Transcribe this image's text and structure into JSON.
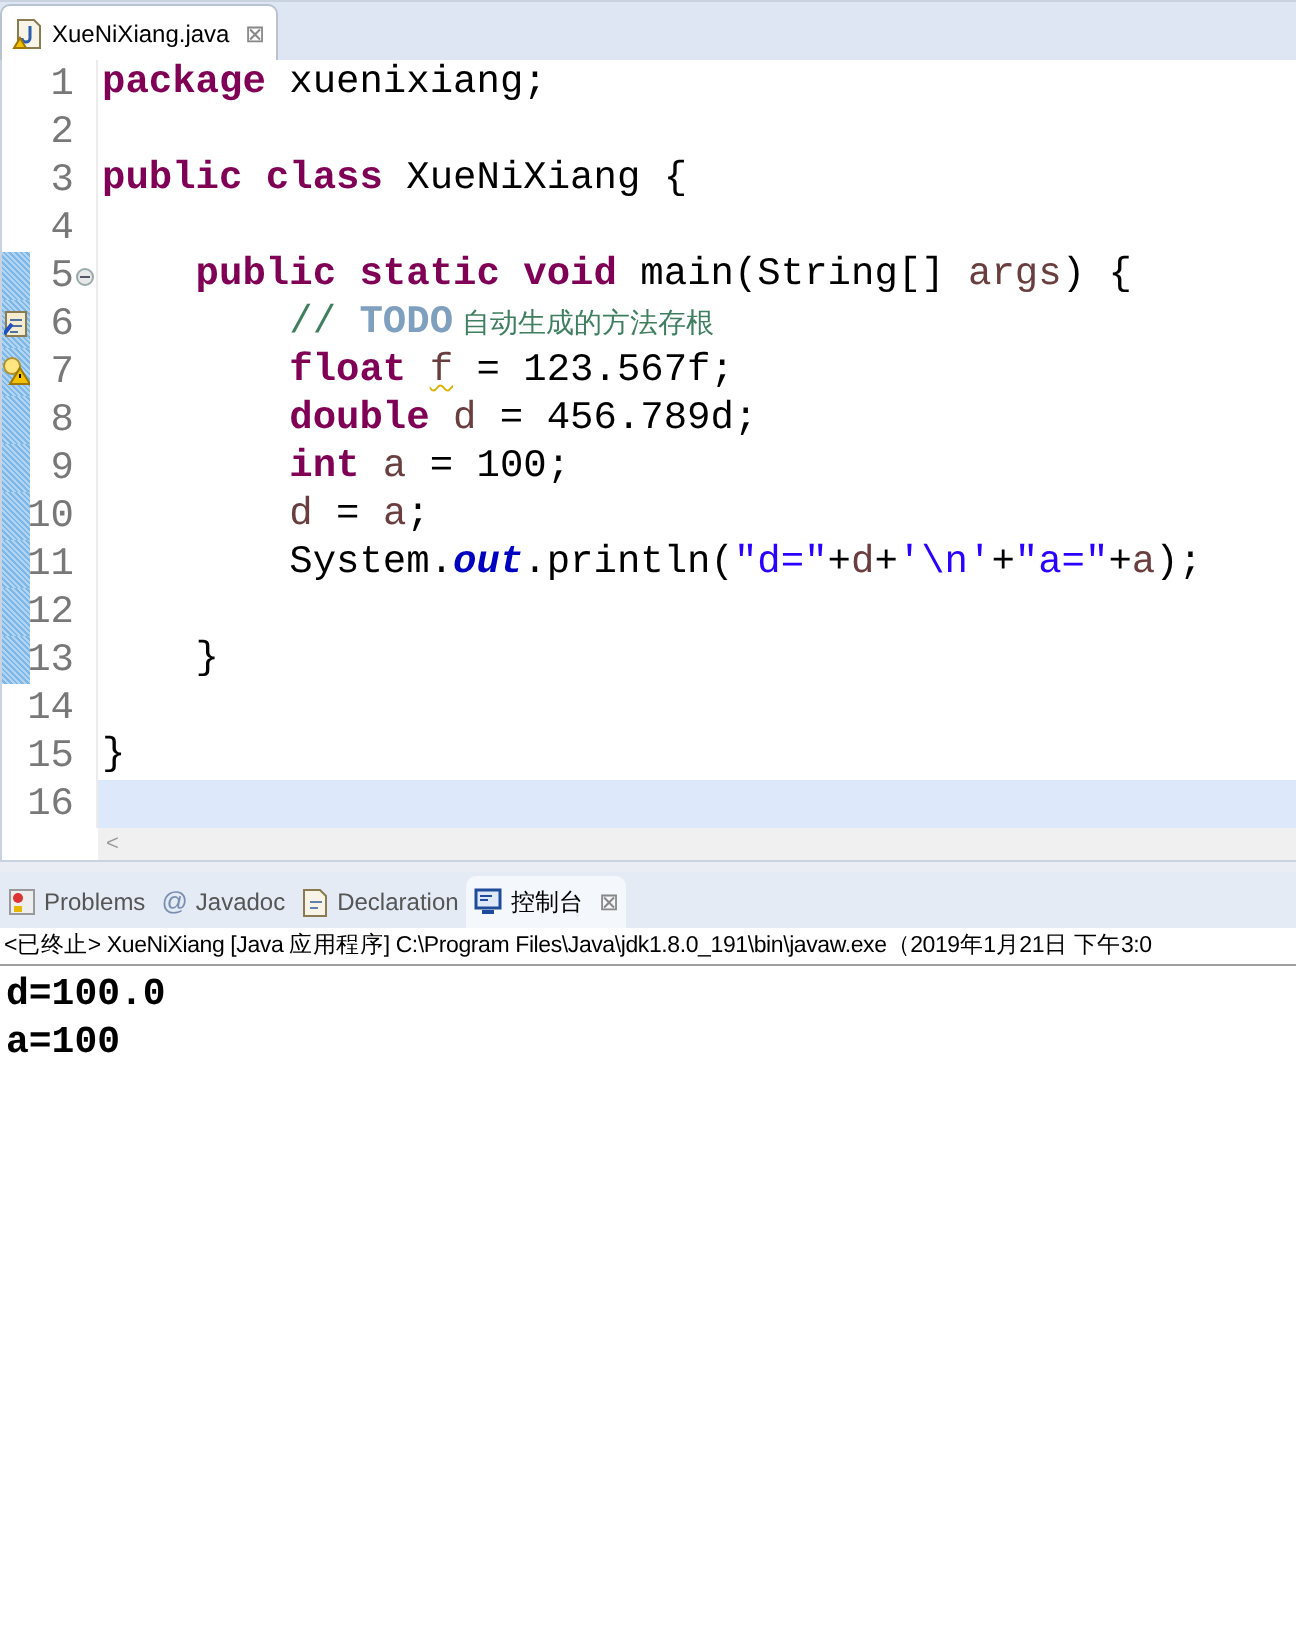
{
  "editor_tab": {
    "title": "XueNiXiang.java",
    "close": "⊠",
    "selected": true
  },
  "lines": [
    {
      "number": "1",
      "changed": false,
      "current": false,
      "fold": false,
      "task": false,
      "warning": false,
      "tokens": [
        {
          "kind": "keyword",
          "text": "package"
        },
        {
          "kind": "plain",
          "text": " xuenixiang;"
        }
      ]
    },
    {
      "number": "2",
      "changed": false,
      "current": false,
      "fold": false,
      "task": false,
      "warning": false
    },
    {
      "number": "3",
      "changed": false,
      "current": false,
      "fold": false,
      "task": false,
      "warning": false,
      "tokens": [
        {
          "kind": "keyword",
          "text": "public"
        },
        {
          "kind": "keyword",
          "text": " class"
        },
        {
          "kind": "plain",
          "text": " XueNiXiang {"
        }
      ]
    },
    {
      "number": "4",
      "changed": false,
      "current": false,
      "fold": false,
      "task": false,
      "warning": false
    },
    {
      "number": "5",
      "changed": true,
      "current": false,
      "fold": true,
      "task": false,
      "warning": false,
      "tokens": [
        {
          "kind": "keyword",
          "text": "    public"
        },
        {
          "kind": "keyword",
          "text": " static"
        },
        {
          "kind": "keyword",
          "text": " void"
        },
        {
          "kind": "plain",
          "text": " main(String[] "
        },
        {
          "kind": "var",
          "text": "args"
        },
        {
          "kind": "plain",
          "text": ") {"
        }
      ]
    },
    {
      "number": "6",
      "changed": true,
      "current": false,
      "fold": false,
      "task": true,
      "warning": false,
      "tokens": [
        {
          "kind": "comment",
          "text": "        //"
        },
        {
          "kind": "todo",
          "text": " TODO"
        },
        {
          "kind": "comment-cjk",
          "text": " 自动生成的方法存根"
        }
      ]
    },
    {
      "number": "7",
      "changed": true,
      "current": false,
      "fold": false,
      "task": false,
      "warning": true,
      "tokens": [
        {
          "kind": "keyword",
          "text": "        float "
        },
        {
          "kind": "var-warning",
          "text": "f"
        },
        {
          "kind": "plain",
          "text": " = 123.567f;"
        }
      ]
    },
    {
      "number": "8",
      "changed": true,
      "current": false,
      "fold": false,
      "task": false,
      "warning": false,
      "tokens": [
        {
          "kind": "keyword",
          "text": "        double"
        },
        {
          "kind": "var",
          "text": " d"
        },
        {
          "kind": "plain",
          "text": " = 456.789d;"
        }
      ]
    },
    {
      "number": "9",
      "changed": true,
      "current": false,
      "fold": false,
      "task": false,
      "warning": false,
      "tokens": [
        {
          "kind": "keyword",
          "text": "        int"
        },
        {
          "kind": "var",
          "text": " a"
        },
        {
          "kind": "plain",
          "text": " = 100;"
        }
      ]
    },
    {
      "number": "10",
      "changed": true,
      "current": false,
      "fold": false,
      "task": false,
      "warning": false,
      "tokens": [
        {
          "kind": "var",
          "text": "        d"
        },
        {
          "kind": "plain",
          "text": " = "
        },
        {
          "kind": "var",
          "text": "a"
        },
        {
          "kind": "plain",
          "text": ";"
        }
      ]
    },
    {
      "number": "11",
      "changed": true,
      "current": false,
      "fold": false,
      "task": false,
      "warning": false,
      "tokens": [
        {
          "kind": "plain",
          "text": "        System."
        },
        {
          "kind": "field",
          "text": "out"
        },
        {
          "kind": "plain",
          "text": ".println("
        },
        {
          "kind": "string",
          "text": "\"d=\""
        },
        {
          "kind": "plain",
          "text": "+"
        },
        {
          "kind": "var",
          "text": "d"
        },
        {
          "kind": "plain",
          "text": "+"
        },
        {
          "kind": "string",
          "text": "'\\n'"
        },
        {
          "kind": "plain",
          "text": "+"
        },
        {
          "kind": "string",
          "text": "\"a=\""
        },
        {
          "kind": "plain",
          "text": "+"
        },
        {
          "kind": "var",
          "text": "a"
        },
        {
          "kind": "plain",
          "text": ");"
        }
      ]
    },
    {
      "number": "12",
      "changed": true,
      "current": false,
      "fold": false,
      "task": false,
      "warning": false
    },
    {
      "number": "13",
      "changed": true,
      "current": false,
      "fold": false,
      "task": false,
      "warning": false,
      "tokens": [
        {
          "kind": "plain",
          "text": "    }"
        }
      ]
    },
    {
      "number": "14",
      "changed": false,
      "current": false,
      "fold": false,
      "task": false,
      "warning": false
    },
    {
      "number": "15",
      "changed": false,
      "current": false,
      "fold": false,
      "task": false,
      "warning": false,
      "tokens": [
        {
          "kind": "plain",
          "text": "}"
        }
      ]
    },
    {
      "number": "16",
      "changed": false,
      "current": true,
      "fold": false,
      "task": false,
      "warning": false
    }
  ],
  "scroll_arrow": "<",
  "view_tabs": [
    {
      "kind": "problems",
      "label": "Problems",
      "selected": false
    },
    {
      "kind": "javadoc",
      "icon": "@",
      "label": "Javadoc",
      "selected": false
    },
    {
      "kind": "declaration",
      "label": "Declaration",
      "selected": false
    },
    {
      "kind": "console",
      "label": "控制台",
      "selected": true,
      "close": "⊠"
    }
  ],
  "console": {
    "header": "<已终止> XueNiXiang [Java 应用程序] C:\\Program Files\\Java\\jdk1.8.0_191\\bin\\javaw.exe（2019年1月21日 下午3:0",
    "output": [
      "d=100.0",
      "a=100"
    ]
  }
}
